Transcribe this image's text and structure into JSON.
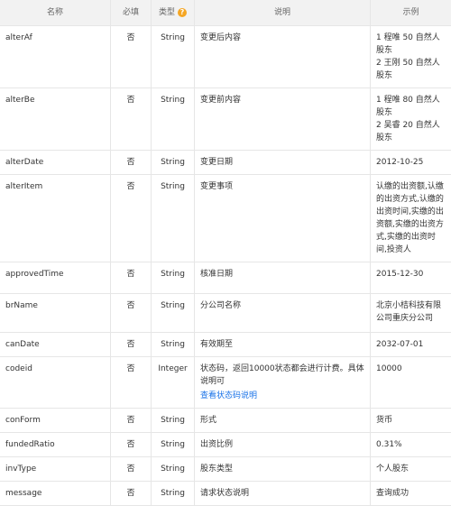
{
  "headers": {
    "name": "名称",
    "required": "必填",
    "type": "类型",
    "description": "说明",
    "example": "示例"
  },
  "rows": [
    {
      "name": "alterAf",
      "required": "否",
      "type": "String",
      "description": "变更后内容",
      "example": "1 程唯 50 自然人股东\n2 王刚 50 自然人股东"
    },
    {
      "name": "alterBe",
      "required": "否",
      "type": "String",
      "description": "变更前内容",
      "example": "1 程唯 80 自然人股东\n2 吴睿 20 自然人股东"
    },
    {
      "name": "alterDate",
      "required": "否",
      "type": "String",
      "description": "变更日期",
      "example": "2012-10-25"
    },
    {
      "name": "alterItem",
      "required": "否",
      "type": "String",
      "description": "变更事项",
      "example": "认缴的出资额,认缴的出资方式,认缴的出资时间,实缴的出资额,实缴的出资方式,实缴的出资时间,投资人"
    },
    {
      "name": "approvedTime",
      "required": "否",
      "type": "String",
      "description": "核准日期",
      "example": "2015-12-30"
    },
    {
      "name": "brName",
      "required": "否",
      "type": "String",
      "description": "分公司名称",
      "example": "北京小桔科技有限公司重庆分公司"
    },
    {
      "name": "canDate",
      "required": "否",
      "type": "String",
      "description": "有效期至",
      "example": "2032-07-01"
    },
    {
      "name": "codeid",
      "required": "否",
      "type": "Integer",
      "description": "状态码，返回10000状态都会进行计费。具体说明可",
      "link": "查看状态码说明",
      "example": "10000"
    },
    {
      "name": "conForm",
      "required": "否",
      "type": "String",
      "description": "形式",
      "example": "货币"
    },
    {
      "name": "fundedRatio",
      "required": "否",
      "type": "String",
      "description": "出资比例",
      "example": "0.31%"
    },
    {
      "name": "invType",
      "required": "否",
      "type": "String",
      "description": "股东类型",
      "example": "个人股东"
    },
    {
      "name": "message",
      "required": "否",
      "type": "String",
      "description": "请求状态说明",
      "example": "查询成功"
    }
  ],
  "icons": {
    "type_help": "question-circle-icon",
    "type_help_glyph": "?"
  },
  "colors": {
    "header_bg": "#f2f2f2",
    "border": "#e6e6e6",
    "link": "#1a73e8",
    "help_icon": "#f5a623"
  }
}
